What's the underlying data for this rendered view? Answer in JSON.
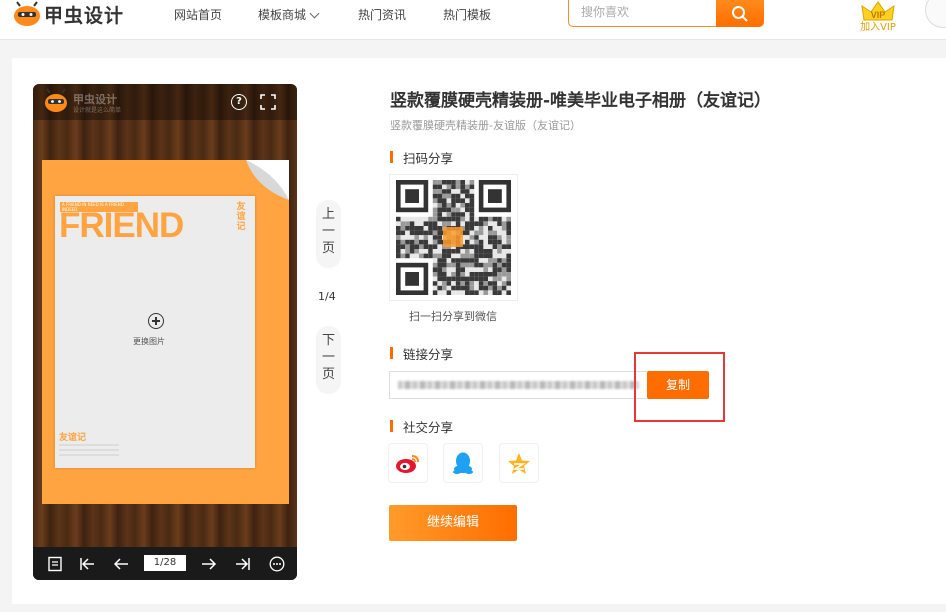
{
  "header": {
    "logo_text": "甲虫设计",
    "nav": [
      {
        "label": "网站首页"
      },
      {
        "label": "模板商城"
      },
      {
        "label": "热门资讯"
      },
      {
        "label": "热门模板"
      }
    ],
    "search_placeholder": "搜你喜欢",
    "vip_label": "加入VIP"
  },
  "preview": {
    "mini_title": "甲虫设计",
    "mini_subtitle": "设计就是这么简单",
    "cover": {
      "strip_text": "A FRIEND IN NEED IS A FRIEND INDEED",
      "title": "FRIEND",
      "vertical_text": "友谊记",
      "replace_label": "更换图片",
      "bottom_title": "友谊记"
    },
    "page_indicator": "1/28"
  },
  "pager": {
    "prev_chars": [
      "上",
      "一",
      "页"
    ],
    "count": "1/4",
    "next_chars": [
      "下",
      "一",
      "页"
    ]
  },
  "info": {
    "title": "竖款覆膜硬壳精装册-唯美毕业电子相册（友谊记）",
    "subtitle": "竖款覆膜硬壳精装册-友谊版（友谊记）",
    "qr_section": "扫码分享",
    "qr_caption": "扫一扫分享到微信",
    "link_section": "链接分享",
    "copy_label": "复制",
    "social_section": "社交分享",
    "continue_label": "继续编辑"
  },
  "colors": {
    "accent": "#ff6d00",
    "cover_orange": "#ffa440",
    "highlight_red": "#e53935"
  }
}
